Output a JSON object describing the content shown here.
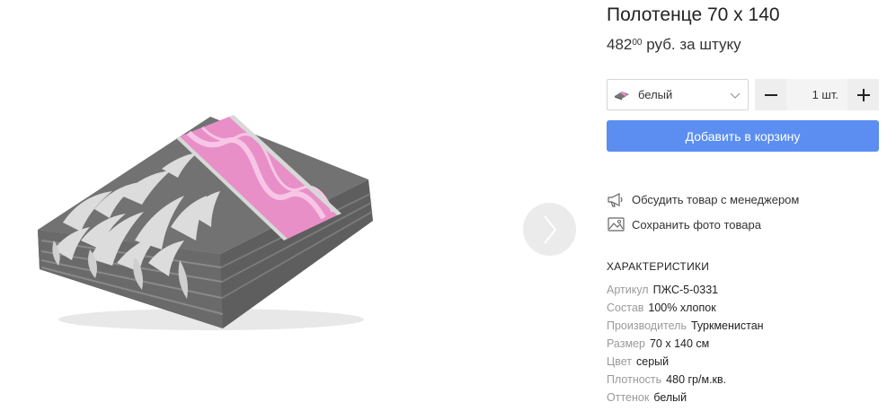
{
  "product": {
    "title": "Полотенце 70 х 140",
    "price_main": "482",
    "price_cents": "00",
    "price_unit": "руб. за штуку"
  },
  "variant": {
    "selected": "белый",
    "swatch_icon": "towel-swatch-icon"
  },
  "quantity": {
    "value": "1 шт.",
    "decrement": "−",
    "increment": "+"
  },
  "cart": {
    "add_label": "Добавить в корзину",
    "button_color": "#5b8ef0"
  },
  "actions": {
    "discuss": "Обсудить товар с менеджером",
    "save_photo": "Сохранить фото товара"
  },
  "specs": {
    "heading": "ХАРАКТЕРИСТИКИ",
    "items": [
      {
        "key": "Артикул",
        "value": "ПЖС-5-0331"
      },
      {
        "key": "Состав",
        "value": "100% хлопок"
      },
      {
        "key": "Производитель",
        "value": "Туркменистан"
      },
      {
        "key": "Размер",
        "value": "70 х 140 см"
      },
      {
        "key": "Цвет",
        "value": "серый"
      },
      {
        "key": "Плотность",
        "value": "480 гр/м.кв."
      },
      {
        "key": "Оттенок",
        "value": "белый"
      }
    ]
  },
  "icons": {
    "next": "chevron-right-icon",
    "discuss": "megaphone-icon",
    "save": "image-icon",
    "dropdown": "chevron-down-icon"
  }
}
